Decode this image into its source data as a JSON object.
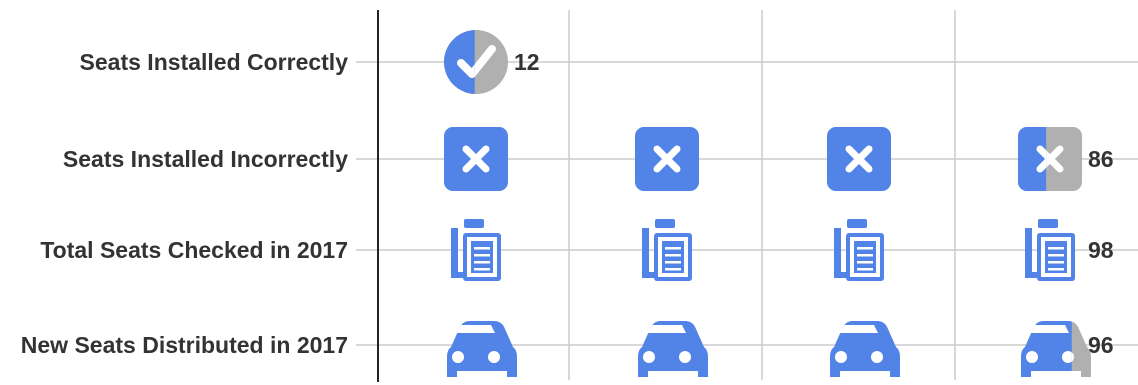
{
  "chart_data": {
    "type": "pictograph",
    "title": "",
    "xlabel": "",
    "ylabel": "",
    "units_per_icon": 25,
    "grid": true,
    "rows": [
      {
        "label": "Seats Installed Correctly",
        "value": 12,
        "value_label": "12",
        "icon": "check-circle-icon"
      },
      {
        "label": "Seats Installed Incorrectly",
        "value": 86,
        "value_label": "86",
        "icon": "close-box-icon"
      },
      {
        "label": "Total Seats Checked in 2017",
        "value": 98,
        "value_label": "98",
        "icon": "clipboard-icon"
      },
      {
        "label": "New Seats Distributed in 2017",
        "value": 96,
        "value_label": "96",
        "icon": "car-icon"
      }
    ]
  },
  "colors": {
    "accent": "#5184e6",
    "remainder": "#b0b0b0",
    "grid": "#cccccc",
    "axis": "#222222",
    "text": "#333333"
  }
}
